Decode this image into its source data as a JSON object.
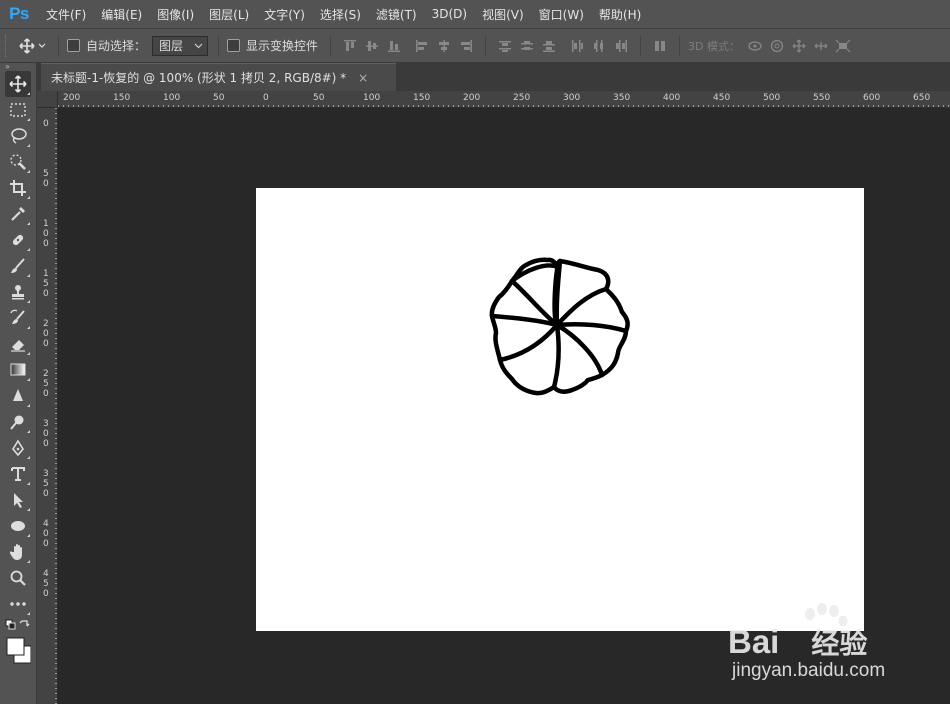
{
  "app": {
    "logo": "Ps"
  },
  "menu": [
    "文件(F)",
    "编辑(E)",
    "图像(I)",
    "图层(L)",
    "文字(Y)",
    "选择(S)",
    "滤镜(T)",
    "3D(D)",
    "视图(V)",
    "窗口(W)",
    "帮助(H)"
  ],
  "options": {
    "auto_select_label": "自动选择：",
    "auto_select_target": "图层",
    "show_transform_label": "显示变换控件",
    "mode_label": "3D 模式："
  },
  "document": {
    "tab_title": "未标题-1-恢复的 @ 100% (形状 1 拷贝 2, RGB/8#) *",
    "close_glyph": "×",
    "canvas_color": "#ffffff"
  },
  "rulers": {
    "horizontal": [
      "200",
      "150",
      "100",
      "50",
      "0",
      "50",
      "100",
      "150",
      "200",
      "250",
      "300",
      "350",
      "400",
      "450",
      "500",
      "550",
      "600",
      "650"
    ],
    "vertical": [
      "0",
      "50",
      "100",
      "150",
      "200",
      "250",
      "300",
      "350",
      "400",
      "450"
    ]
  },
  "tools": [
    "move-tool",
    "marquee-tool",
    "lasso-tool",
    "quick-select-tool",
    "crop-tool",
    "eyedropper-tool",
    "healing-brush-tool",
    "brush-tool",
    "clone-stamp-tool",
    "history-brush-tool",
    "eraser-tool",
    "gradient-tool",
    "blur-tool",
    "dodge-tool",
    "pen-tool",
    "type-tool",
    "path-select-tool",
    "shape-tool",
    "hand-tool",
    "zoom-tool",
    "more-tools"
  ],
  "watermark": {
    "brand": "Bai",
    "brand_cn": "经验",
    "url": "jingyan.baidu.com"
  },
  "colors": {
    "accent": "#31a8ff",
    "ui_bg": "#535353",
    "workspace": "#282828"
  }
}
